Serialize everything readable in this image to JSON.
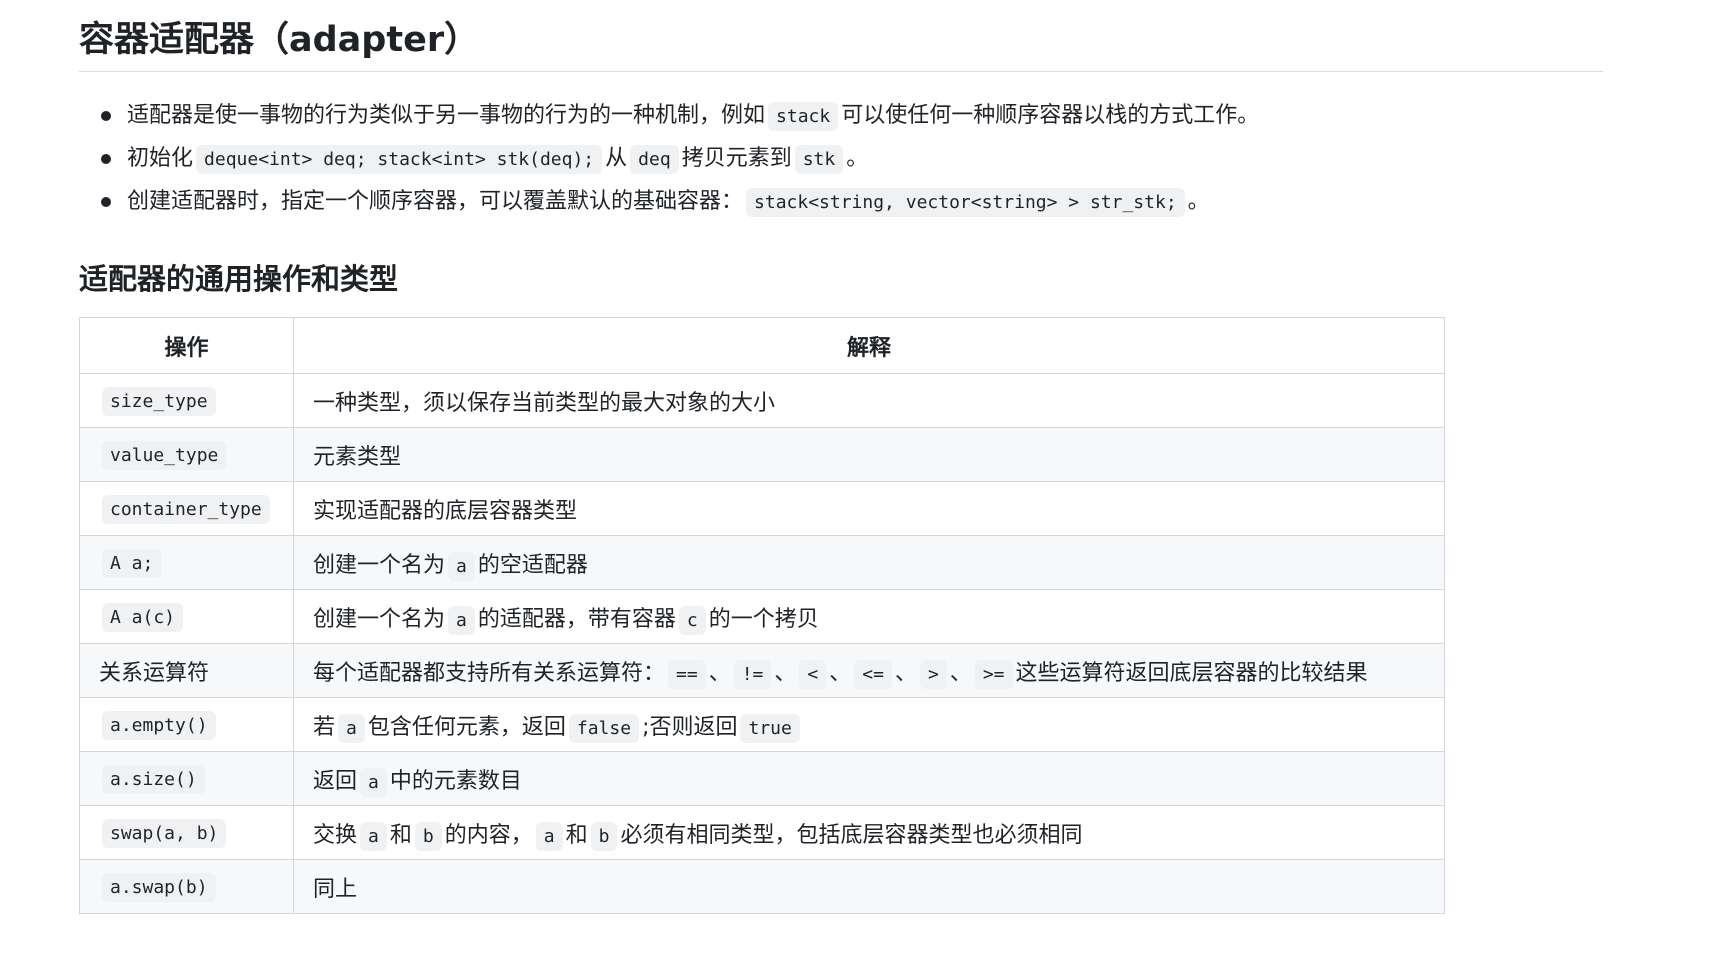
{
  "heading": "容器适配器（adapter）",
  "bullets": [
    {
      "parts": [
        {
          "t": "text",
          "v": "适配器是使一事物的行为类似于另一事物的行为的一种机制，例如"
        },
        {
          "t": "code",
          "v": "stack"
        },
        {
          "t": "text",
          "v": "可以使任何一种顺序容器以栈的方式工作。"
        }
      ]
    },
    {
      "parts": [
        {
          "t": "text",
          "v": "初始化"
        },
        {
          "t": "code",
          "v": "deque<int> deq; stack<int> stk(deq);"
        },
        {
          "t": "text",
          "v": "从"
        },
        {
          "t": "code",
          "v": "deq"
        },
        {
          "t": "text",
          "v": "拷贝元素到"
        },
        {
          "t": "code",
          "v": "stk"
        },
        {
          "t": "text",
          "v": "。"
        }
      ]
    },
    {
      "parts": [
        {
          "t": "text",
          "v": "创建适配器时，指定一个顺序容器，可以覆盖默认的基础容器："
        },
        {
          "t": "code",
          "v": "stack<string, vector<string> > str_stk;"
        },
        {
          "t": "text",
          "v": "。"
        }
      ]
    }
  ],
  "subheading": "适配器的通用操作和类型",
  "table": {
    "headers": [
      "操作",
      "解释"
    ],
    "rows": [
      {
        "op": {
          "t": "code",
          "v": "size_type"
        },
        "desc": [
          {
            "t": "text",
            "v": "一种类型，须以保存当前类型的最大对象的大小"
          }
        ]
      },
      {
        "op": {
          "t": "code",
          "v": "value_type"
        },
        "desc": [
          {
            "t": "text",
            "v": "元素类型"
          }
        ]
      },
      {
        "op": {
          "t": "code",
          "v": "container_type"
        },
        "desc": [
          {
            "t": "text",
            "v": "实现适配器的底层容器类型"
          }
        ]
      },
      {
        "op": {
          "t": "code",
          "v": "A a;"
        },
        "desc": [
          {
            "t": "text",
            "v": "创建一个名为"
          },
          {
            "t": "code",
            "v": "a"
          },
          {
            "t": "text",
            "v": "的空适配器"
          }
        ]
      },
      {
        "op": {
          "t": "code",
          "v": "A a(c)"
        },
        "desc": [
          {
            "t": "text",
            "v": "创建一个名为"
          },
          {
            "t": "code",
            "v": "a"
          },
          {
            "t": "text",
            "v": "的适配器，带有容器"
          },
          {
            "t": "code",
            "v": "c"
          },
          {
            "t": "text",
            "v": "的一个拷贝"
          }
        ]
      },
      {
        "op": {
          "t": "text",
          "v": "关系运算符"
        },
        "desc": [
          {
            "t": "text",
            "v": "每个适配器都支持所有关系运算符："
          },
          {
            "t": "code",
            "v": "=="
          },
          {
            "t": "text",
            "v": "、"
          },
          {
            "t": "code",
            "v": "!="
          },
          {
            "t": "text",
            "v": "、"
          },
          {
            "t": "code",
            "v": "<"
          },
          {
            "t": "text",
            "v": "、"
          },
          {
            "t": "code",
            "v": "<="
          },
          {
            "t": "text",
            "v": "、"
          },
          {
            "t": "code",
            "v": ">"
          },
          {
            "t": "text",
            "v": "、"
          },
          {
            "t": "code",
            "v": ">="
          },
          {
            "t": "text",
            "v": "这些运算符返回底层容器的比较结果"
          }
        ]
      },
      {
        "op": {
          "t": "code",
          "v": "a.empty()"
        },
        "desc": [
          {
            "t": "text",
            "v": "若"
          },
          {
            "t": "code",
            "v": "a"
          },
          {
            "t": "text",
            "v": "包含任何元素，返回"
          },
          {
            "t": "code",
            "v": "false"
          },
          {
            "t": "text",
            "v": ";否则返回"
          },
          {
            "t": "code",
            "v": "true"
          }
        ]
      },
      {
        "op": {
          "t": "code",
          "v": "a.size()"
        },
        "desc": [
          {
            "t": "text",
            "v": "返回"
          },
          {
            "t": "code",
            "v": "a"
          },
          {
            "t": "text",
            "v": "中的元素数目"
          }
        ]
      },
      {
        "op": {
          "t": "code",
          "v": "swap(a, b)"
        },
        "desc": [
          {
            "t": "text",
            "v": "交换"
          },
          {
            "t": "code",
            "v": "a"
          },
          {
            "t": "text",
            "v": "和"
          },
          {
            "t": "code",
            "v": "b"
          },
          {
            "t": "text",
            "v": "的内容，"
          },
          {
            "t": "code",
            "v": "a"
          },
          {
            "t": "text",
            "v": "和"
          },
          {
            "t": "code",
            "v": "b"
          },
          {
            "t": "text",
            "v": "必须有相同类型，包括底层容器类型也必须相同"
          }
        ]
      },
      {
        "op": {
          "t": "code",
          "v": "a.swap(b)"
        },
        "desc": [
          {
            "t": "text",
            "v": "同上"
          }
        ]
      }
    ]
  }
}
